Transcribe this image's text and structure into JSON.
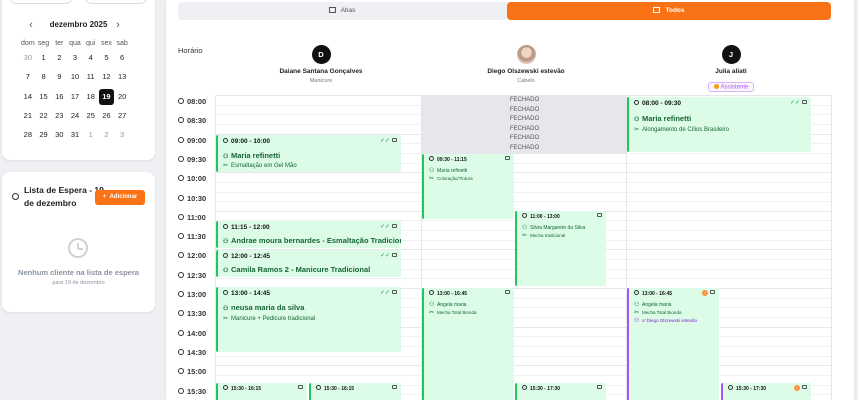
{
  "calendar": {
    "month_title": "dezembro 2025",
    "prev_icon": "chevron-left-icon",
    "next_icon": "chevron-right-icon",
    "weekdays": [
      "dom",
      "seg",
      "ter",
      "qua",
      "qui",
      "sex",
      "sab"
    ],
    "weeks": [
      [
        "30",
        "1",
        "2",
        "3",
        "4",
        "5",
        "6"
      ],
      [
        "7",
        "8",
        "9",
        "10",
        "11",
        "12",
        "13"
      ],
      [
        "14",
        "15",
        "16",
        "17",
        "18",
        "19",
        "20"
      ],
      [
        "21",
        "22",
        "23",
        "24",
        "25",
        "26",
        "27"
      ],
      [
        "28",
        "29",
        "30",
        "31",
        "1",
        "2",
        "3"
      ]
    ],
    "selected_day": "19"
  },
  "waitlist": {
    "title": "Lista de Espera - 19 de dezembro",
    "add_label": "Adicionar",
    "empty_text": "Nenhum cliente na lista de espera",
    "empty_sub": "para 19 de dezembro"
  },
  "tabs": {
    "abas": "Abas",
    "todos": "Todos"
  },
  "schedule": {
    "horario_label": "Horário",
    "staff": [
      {
        "initial": "D",
        "name": "Daiane Santana Gonçalves",
        "role": "Manicure"
      },
      {
        "initial": "",
        "name": "Diego Olszewski estevão",
        "role": "Cabelo"
      },
      {
        "initial": "J",
        "name": "Julia aliati",
        "role": "",
        "badge": "Assistente"
      }
    ],
    "times": [
      "08:00",
      "08:30",
      "09:00",
      "09:30",
      "10:00",
      "10:30",
      "11:00",
      "11:30",
      "12:00",
      "12:30",
      "13:00",
      "13:30",
      "14:00",
      "14:30",
      "15:00",
      "15:30"
    ],
    "closed_label": "FECHADO",
    "appointments": [
      {
        "time": "08:00 - 09:30",
        "client": "Maria refinetti",
        "service": "Alongamento de Cílios Brasileiro",
        "status": "✓✓"
      },
      {
        "time": "09:00 - 10:00",
        "client": "Maria refinetti",
        "service": "Esmaltação em Gel Mão",
        "status": "✓✓"
      },
      {
        "time": "09:30 - 11:15",
        "client": "Maria refinetti",
        "service": "Coloração/Tintura",
        "status": ""
      },
      {
        "time": "11:00 - 13:00",
        "client": "Silvia Margarete da Silva",
        "service": "Mecha tradicional",
        "status": ""
      },
      {
        "time": "11:15 - 12:00",
        "client": "Andrae moura bernardes - Esmaltação Tradicional",
        "service": "",
        "status": "✓✓"
      },
      {
        "time": "12:00 - 12:45",
        "client": "Camila Ramos 2 - Manicure Tradicional",
        "service": "",
        "status": "✓✓"
      },
      {
        "time": "13:00 - 14:45",
        "client": "neusa maria da silva",
        "service": "Manicure + Pedicure tradicional",
        "status": "✓✓"
      },
      {
        "time": "13:00 - 16:45",
        "client": "Angela maria",
        "service": "Mecha Total Bionda",
        "status": ""
      },
      {
        "time": "13:00 - 16:45",
        "client": "Angela maria",
        "service": "Mecha Total Bionda",
        "extra": "c/ Diego Olszewski estevão",
        "status": ""
      },
      {
        "time": "15:30 - 16:15",
        "client": "",
        "service": "",
        "status": ""
      },
      {
        "time": "15:30 - 16:15",
        "client": "",
        "service": "",
        "status": ""
      },
      {
        "time": "15:30 - 17:30",
        "client": "",
        "service": "",
        "status": ""
      },
      {
        "time": "15:30 - 17:30",
        "client": "",
        "service": "",
        "status": ""
      }
    ]
  },
  "colors": {
    "accent": "#f97316",
    "appt_bg": "#dcfce7",
    "appt_border": "#22c55e",
    "assist_border": "#a855f7"
  }
}
